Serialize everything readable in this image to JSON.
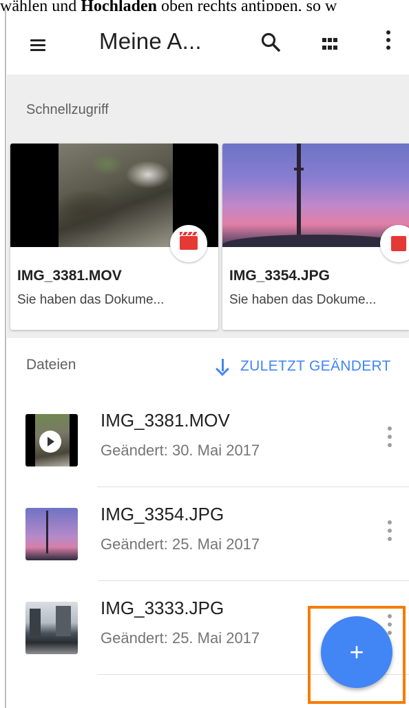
{
  "caption": {
    "prefix": "wählen und ",
    "bold": "Hochladen",
    "suffix": " oben rechts antippen, so w"
  },
  "appbar": {
    "title": "Meine A...",
    "icons": [
      "menu-icon",
      "search-icon",
      "grid-view-icon",
      "more-vert-icon"
    ]
  },
  "quick_access": {
    "heading": "Schnellzugriff",
    "cards": [
      {
        "name": "IMG_3381.MOV",
        "subtitle": "Sie haben das Dokume...",
        "type_icon": "video-icon"
      },
      {
        "name": "IMG_3354.JPG",
        "subtitle": "Sie haben das Dokume...",
        "type_icon": "image-icon"
      }
    ]
  },
  "files": {
    "label": "Dateien",
    "sort_label": "ZULETZT GEÄNDERT",
    "items": [
      {
        "name": "IMG_3381.MOV",
        "date": "Geändert: 30. Mai 2017"
      },
      {
        "name": "IMG_3354.JPG",
        "date": "Geändert: 25. Mai 2017"
      },
      {
        "name": "IMG_3333.JPG",
        "date": "Geändert: 25. Mai 2017"
      }
    ]
  },
  "fab": {
    "label": "+"
  },
  "colors": {
    "accent": "#4285f4",
    "highlight": "#f57c00",
    "badge_red": "#e53935"
  }
}
